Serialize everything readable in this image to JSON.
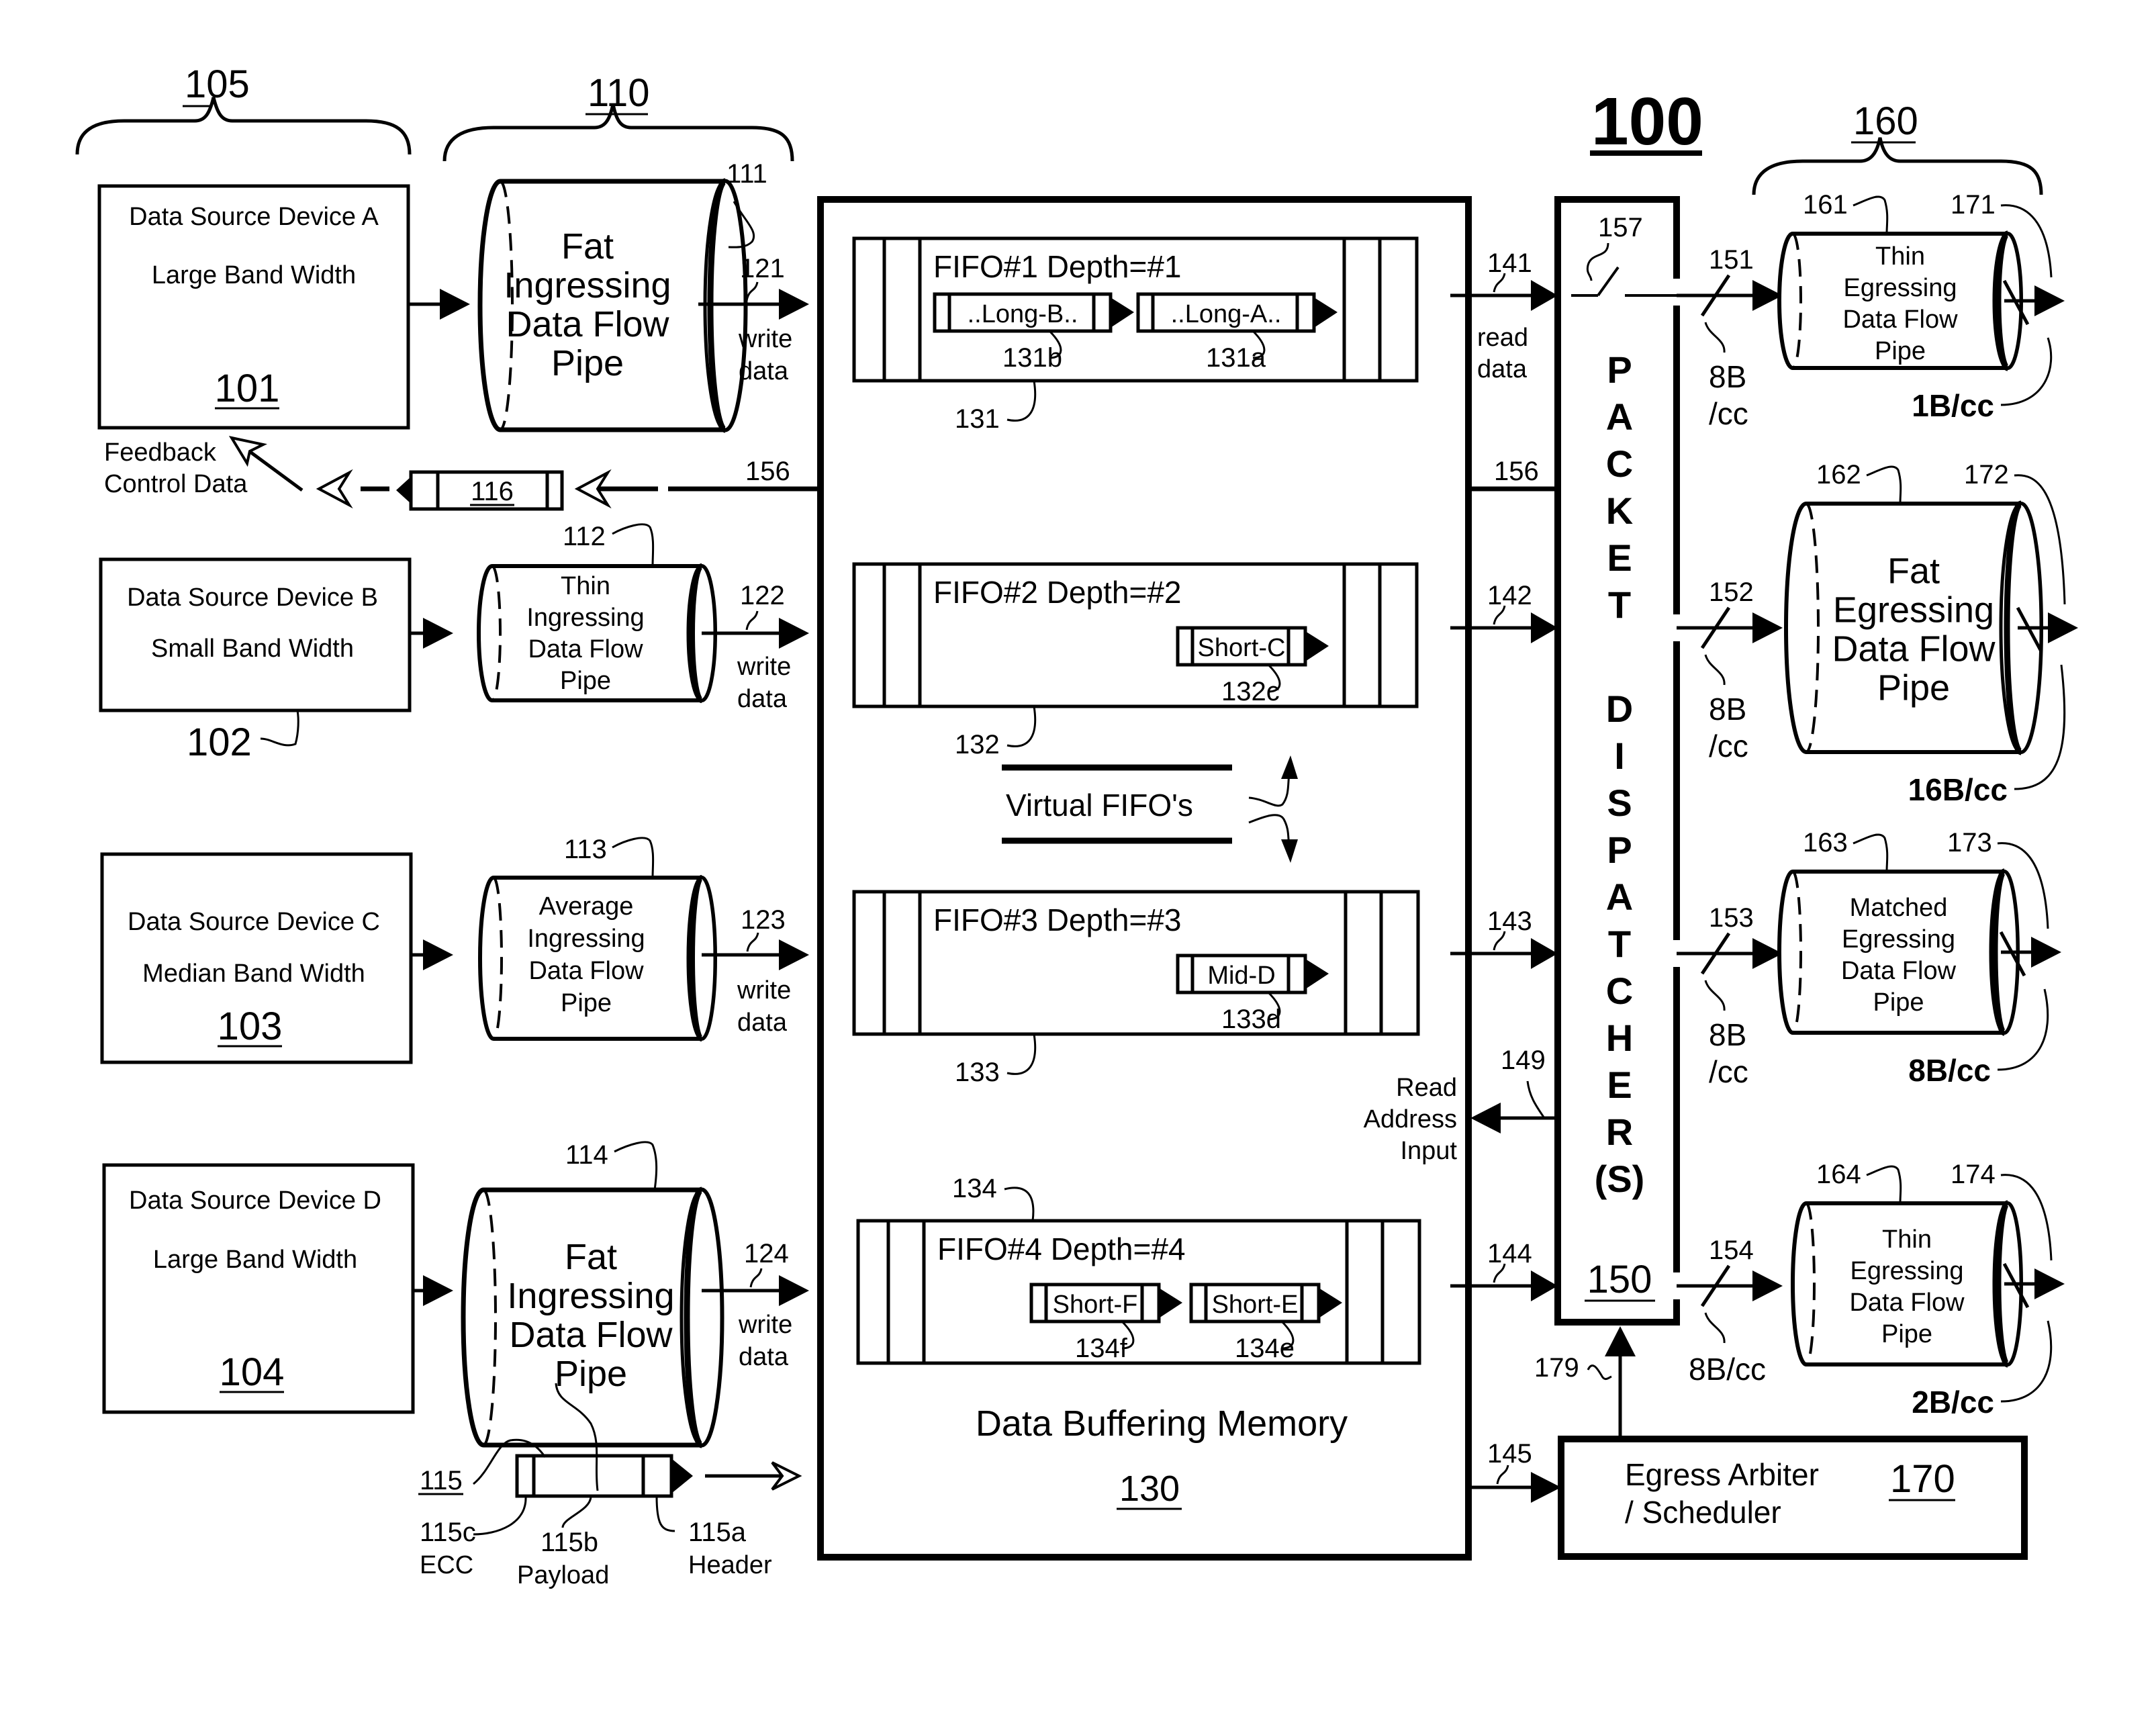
{
  "figure": {
    "ref": "100",
    "groups": {
      "sources": "105",
      "ingress_pipes": "110",
      "egress_pipes": "160"
    }
  },
  "sources": [
    {
      "title": "Data Source Device A",
      "bandwidth": "Large Band Width",
      "ref": "101"
    },
    {
      "title": "Data Source Device B",
      "bandwidth": "Small Band Width",
      "ref": "102"
    },
    {
      "title": "Data Source Device C",
      "bandwidth": "Median Band Width",
      "ref": "103"
    },
    {
      "title": "Data Source Device D",
      "bandwidth": "Large Band Width",
      "ref": "104"
    }
  ],
  "ingress_pipes": [
    {
      "lines": [
        "Fat",
        "Ingressing",
        "Data Flow",
        "Pipe"
      ],
      "ref": "111",
      "write_ref": "121"
    },
    {
      "lines": [
        "Thin",
        "Ingressing",
        "Data Flow",
        "Pipe"
      ],
      "ref": "112",
      "write_ref": "122"
    },
    {
      "lines": [
        "Average",
        "Ingressing",
        "Data Flow",
        "Pipe"
      ],
      "ref": "113",
      "write_ref": "123"
    },
    {
      "lines": [
        "Fat",
        "Ingressing",
        "Data Flow",
        "Pipe"
      ],
      "ref": "114",
      "write_ref": "124"
    }
  ],
  "write_label": [
    "write",
    "data"
  ],
  "read_label": [
    "read",
    "data"
  ],
  "feedback": {
    "label": [
      "Feedback",
      "Control Data"
    ],
    "packet_ref": "116",
    "line_ref": "156"
  },
  "packet_115": {
    "ref": "115",
    "parts": [
      {
        "ref": "115c",
        "name": "ECC"
      },
      {
        "ref": "115b",
        "name": "Payload"
      },
      {
        "ref": "115a",
        "name": "Header"
      }
    ]
  },
  "memory": {
    "title": "Data Buffering Memory",
    "ref": "130",
    "virtual_label": "Virtual FIFO's",
    "fifos": [
      {
        "title": "FIFO#1 Depth=#1",
        "ref": "131",
        "read_ref": "141",
        "packets": [
          {
            "label": "..Long-B..",
            "ref": "131b"
          },
          {
            "label": "..Long-A..",
            "ref": "131a"
          }
        ]
      },
      {
        "title": "FIFO#2 Depth=#2",
        "ref": "132",
        "read_ref": "142",
        "packets": [
          {
            "label": "Short-C",
            "ref": "132c"
          }
        ]
      },
      {
        "title": "FIFO#3 Depth=#3",
        "ref": "133",
        "read_ref": "143",
        "packets": [
          {
            "label": "Mid-D",
            "ref": "133d"
          }
        ]
      },
      {
        "title": "FIFO#4 Depth=#4",
        "ref": "134",
        "read_ref": "144",
        "packets": [
          {
            "label": "Short-F",
            "ref": "134f"
          },
          {
            "label": "Short-E",
            "ref": "134e"
          }
        ]
      }
    ],
    "read_address": {
      "label": [
        "Read",
        "Address",
        "Input"
      ],
      "ref": "149"
    },
    "arbiter_link_ref": "145"
  },
  "dispatcher": {
    "title_letters": [
      "P",
      "A",
      "C",
      "K",
      "E",
      "T",
      "D",
      "I",
      "S",
      "P",
      "A",
      "T",
      "C",
      "H",
      "E",
      "R",
      "(S)"
    ],
    "ref": "150",
    "switch_ref": "157"
  },
  "egress_links": [
    {
      "ref": "151",
      "rate": [
        "8B",
        "/cc"
      ]
    },
    {
      "ref": "152",
      "rate": [
        "8B",
        "/cc"
      ]
    },
    {
      "ref": "153",
      "rate": [
        "8B",
        "/cc"
      ]
    },
    {
      "ref": "154",
      "rate": [
        "8B/cc"
      ]
    }
  ],
  "egress_pipes": [
    {
      "lines": [
        "Thin",
        "Egressing",
        "Data Flow",
        "Pipe"
      ],
      "ref": "161",
      "out_ref": "171",
      "rate": "1B/cc"
    },
    {
      "lines": [
        "Fat",
        "Egressing",
        "Data Flow",
        "Pipe"
      ],
      "ref": "162",
      "out_ref": "172",
      "rate": "16B/cc"
    },
    {
      "lines": [
        "Matched",
        "Egressing",
        "Data Flow",
        "Pipe"
      ],
      "ref": "163",
      "out_ref": "173",
      "rate": "8B/cc"
    },
    {
      "lines": [
        "Thin",
        "Egressing",
        "Data Flow",
        "Pipe"
      ],
      "ref": "164",
      "out_ref": "174",
      "rate": "2B/cc"
    }
  ],
  "arbiter": {
    "lines": [
      "Egress Arbiter",
      "/ Scheduler"
    ],
    "ref": "170",
    "control_ref": "179"
  }
}
